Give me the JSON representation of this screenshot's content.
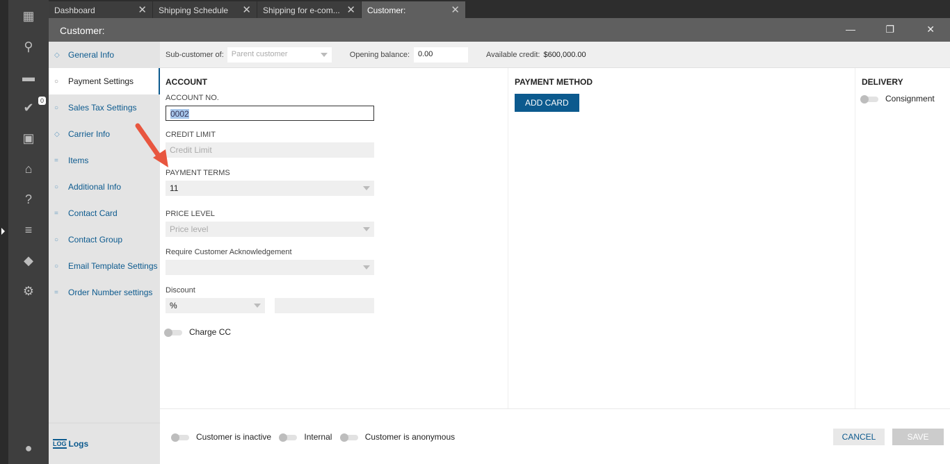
{
  "tabs": [
    {
      "label": "Dashboard"
    },
    {
      "label": "Shipping Schedule"
    },
    {
      "label": "Shipping for e-com..."
    },
    {
      "label": "Customer:"
    }
  ],
  "window": {
    "title": "Customer:"
  },
  "rail": {
    "badge": "0"
  },
  "nav": {
    "items": [
      {
        "label": "General Info"
      },
      {
        "label": "Payment Settings"
      },
      {
        "label": "Sales Tax Settings"
      },
      {
        "label": "Carrier Info"
      },
      {
        "label": "Items"
      },
      {
        "label": "Additional Info"
      },
      {
        "label": "Contact Card"
      },
      {
        "label": "Contact Group"
      },
      {
        "label": "Email Template Settings"
      },
      {
        "label": "Order Number settings"
      }
    ],
    "logs_icon": "LOG",
    "logs": "Logs"
  },
  "topbar": {
    "sub_label": "Sub-customer of:",
    "sub_placeholder": "Parent customer",
    "opening_label": "Opening balance:",
    "opening_value": "0.00",
    "credit_label": "Available credit:",
    "credit_value": "$600,000.00"
  },
  "account": {
    "title": "ACCOUNT",
    "acct_label": "ACCOUNT NO.",
    "acct_value": "0002",
    "credit_label": "CREDIT LIMIT",
    "credit_placeholder": "Credit Limit",
    "terms_label": "PAYMENT TERMS",
    "terms_value": "11",
    "price_label": "PRICE LEVEL",
    "price_placeholder": "Price level",
    "ack_label": "Require Customer Acknowledgement",
    "discount_label": "Discount",
    "discount_type": "%",
    "charge_cc": "Charge CC"
  },
  "payment": {
    "title": "PAYMENT METHOD",
    "add_card": "ADD CARD"
  },
  "delivery": {
    "title": "DELIVERY",
    "consignment": "Consignment"
  },
  "footer": {
    "inactive": "Customer is inactive",
    "internal": "Internal",
    "anonymous": "Customer is anonymous",
    "cancel": "CANCEL",
    "save": "SAVE"
  },
  "colors": {
    "accent": "#0c5a8e",
    "arrow": "#e8563f"
  }
}
